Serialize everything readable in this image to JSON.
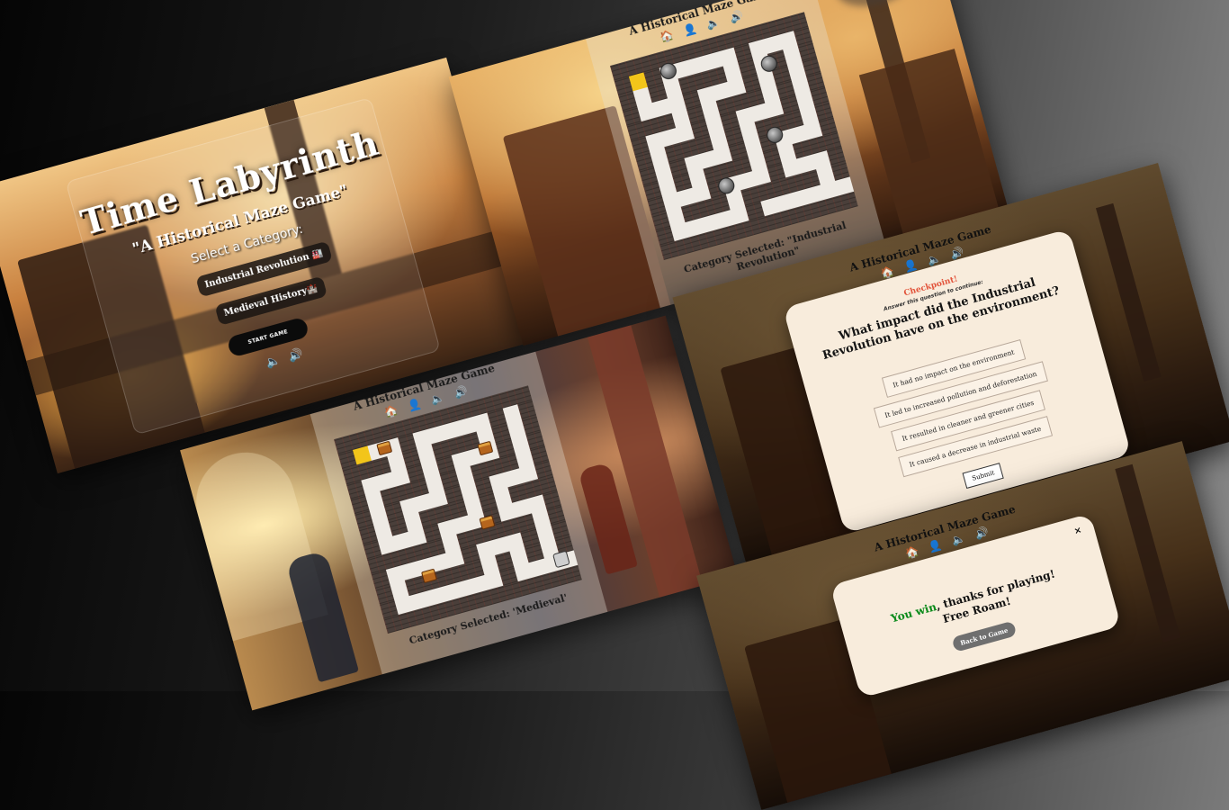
{
  "game": {
    "title": "Time Labyrinth",
    "subtitle": "\"A Historical Maze Game\"",
    "select_label": "Select a Category:",
    "categories": [
      "Industrial Revolution 🏭",
      "Medieval History🏰"
    ],
    "start_button": "START GAME",
    "sound_icons": "🔈 🔊"
  },
  "maze_screen": {
    "title": "A Historical Maze Game",
    "nav_icons": "🏠 👤 🔈 🔊",
    "caption_industrial": "Category Selected: \"Industrial Revolution\"",
    "caption_medieval": "Category Selected: 'Medieval'"
  },
  "quiz_modal": {
    "checkpoint": "Checkpoint!",
    "instruction": "Answer this question to continue:",
    "question": "What impact did the Industrial Revolution have on the environment?",
    "options": [
      "It had no impact on the environment",
      "It led to increased pollution and deforestation",
      "It resulted in cleaner and greener cities",
      "It caused a decrease in industrial waste"
    ],
    "submit_label": "Submit"
  },
  "win_modal": {
    "win_lead": "You win",
    "win_rest": ", thanks for playing!",
    "free_roam": "Free Roam!",
    "back_button": "Back to Game",
    "close_icon": "×"
  },
  "colors": {
    "checkpoint": "#e2533a",
    "win": "#0a8a1a",
    "start_cell": "#f2c51a",
    "modal_bg": "#f8ecdc"
  }
}
